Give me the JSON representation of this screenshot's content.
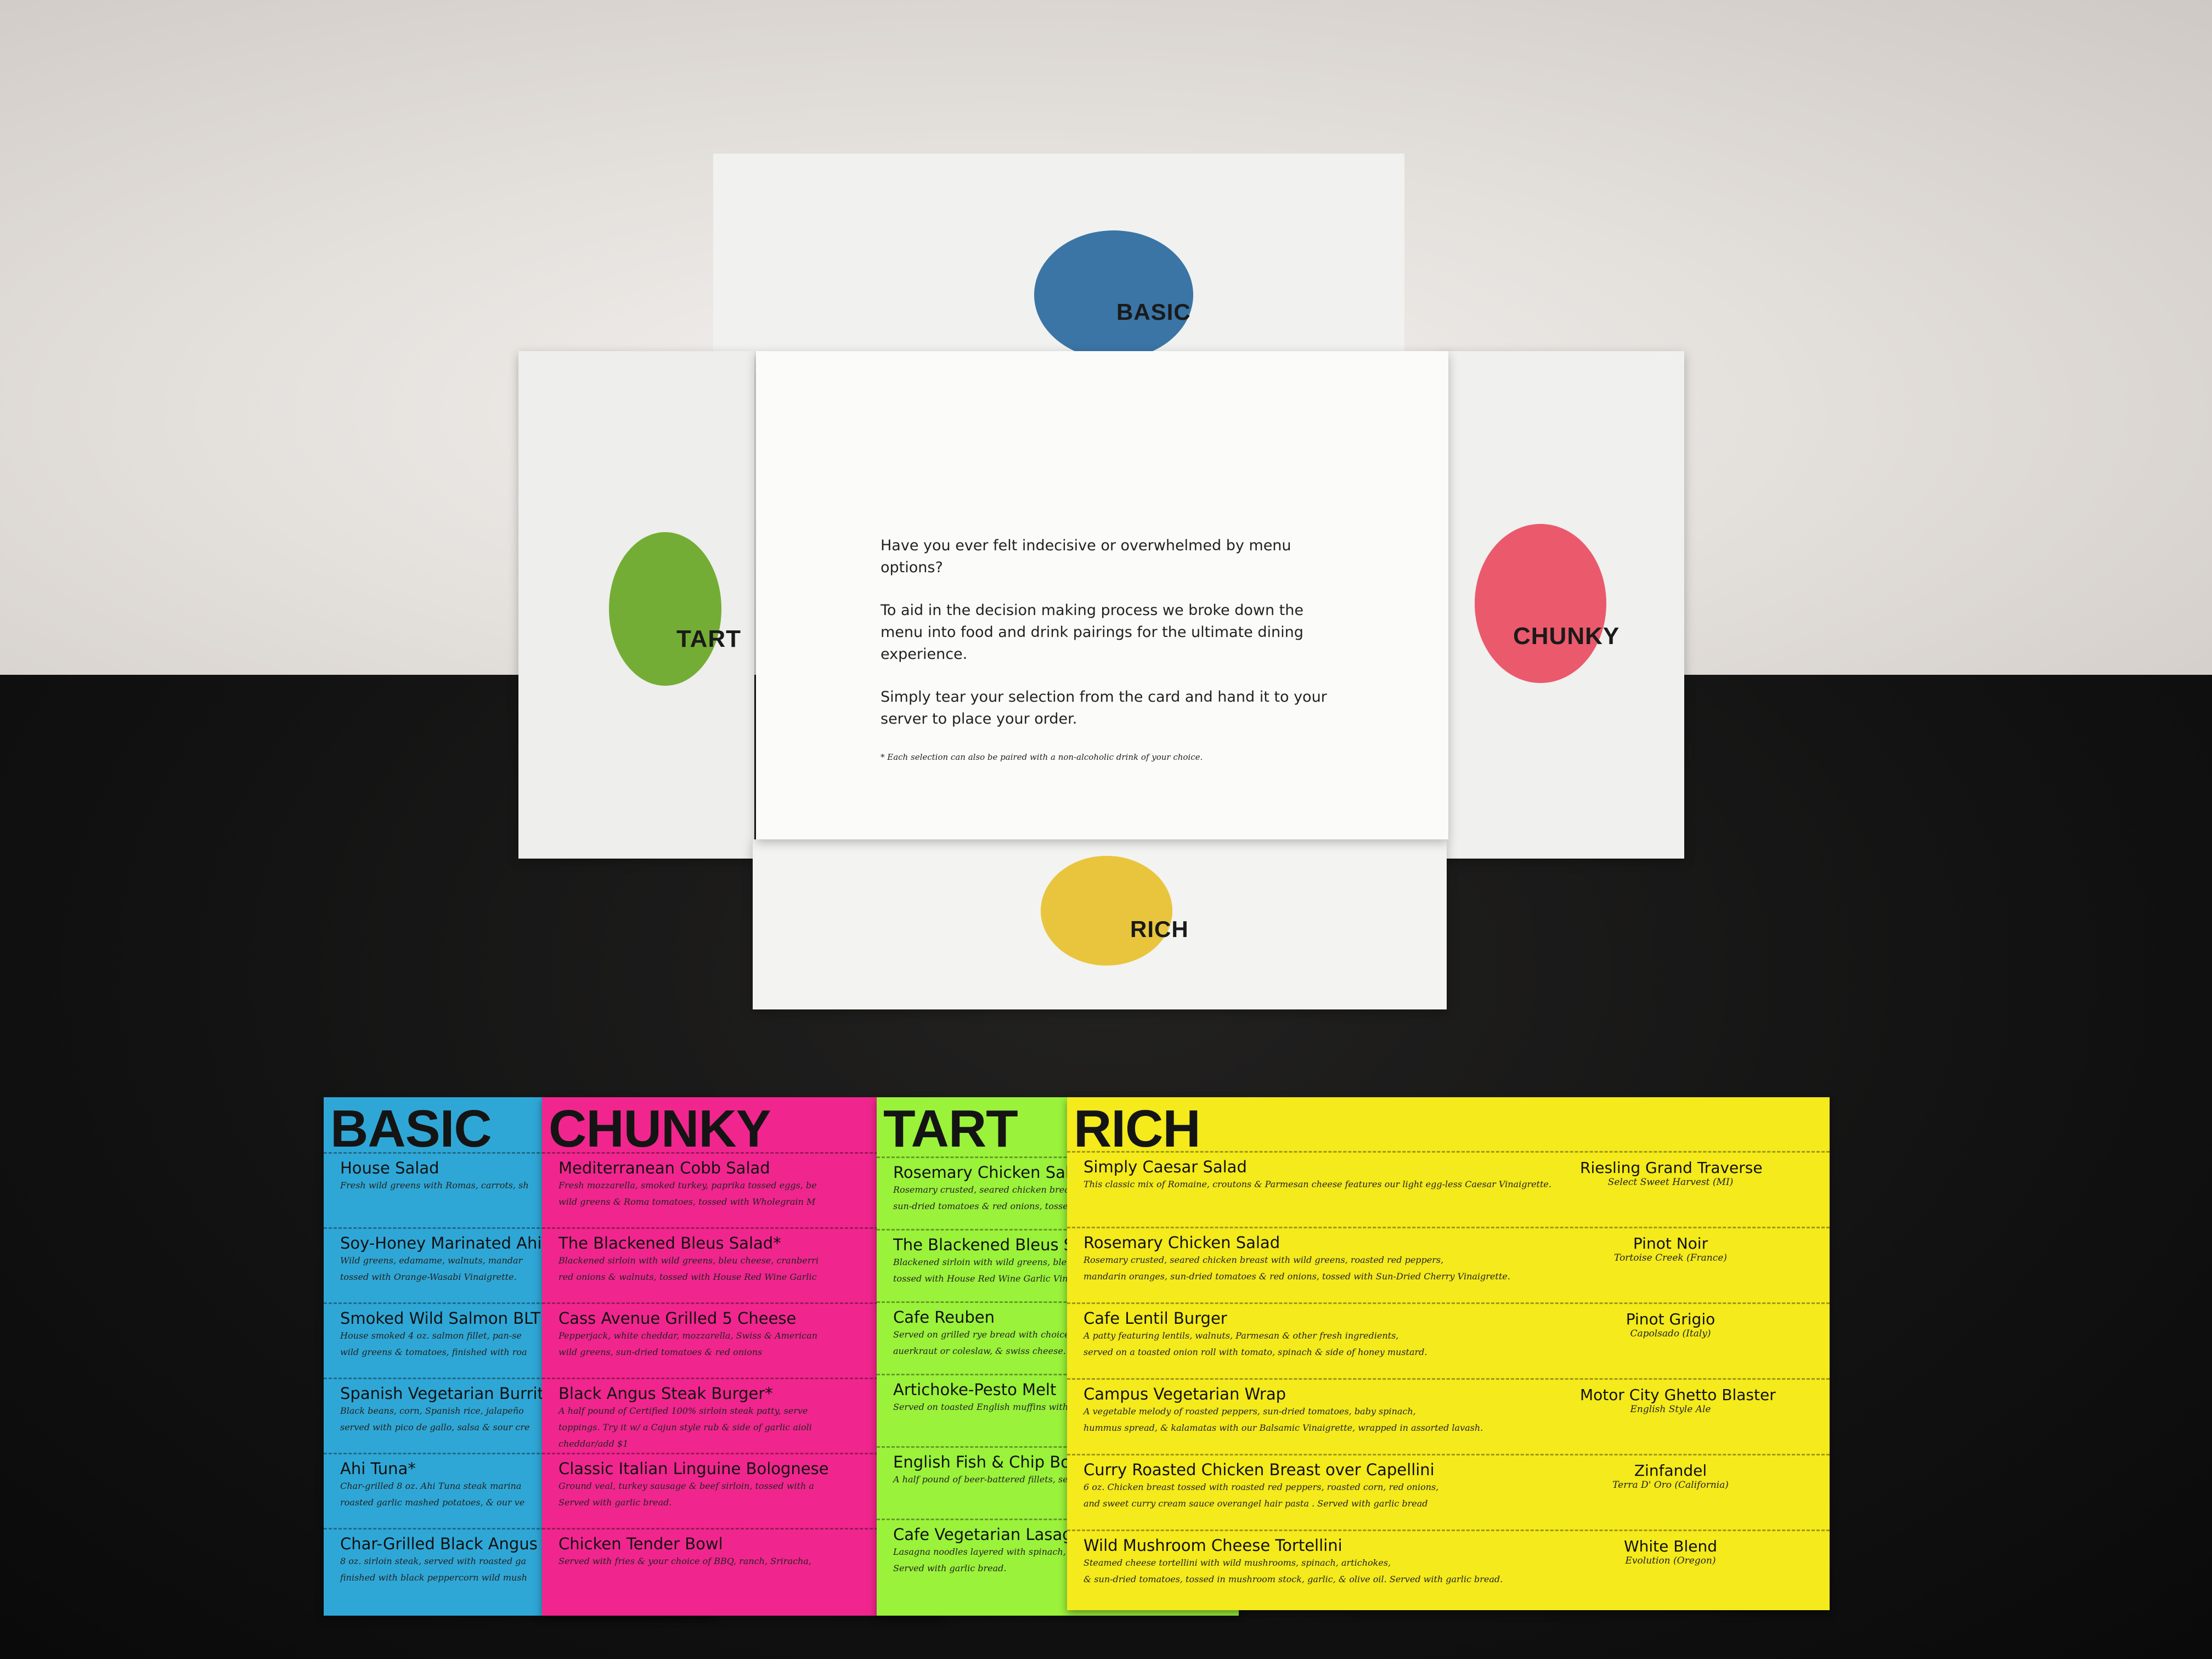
{
  "colors": {
    "basic": "#2fa7d6",
    "chunky": "#f0268e",
    "tart": "#9af23a",
    "rich": "#f4ea1c",
    "basic_circle": "#3a75a6",
    "tart_circle": "#74ad35",
    "chunky_circle": "#ea5a6c",
    "rich_circle": "#e8c53d"
  },
  "folder": {
    "flaps": {
      "top": "BASIC",
      "left": "TART",
      "right": "CHUNKY",
      "bottom": "RICH"
    },
    "intro": [
      "Have you ever felt indecisive or overwhelmed by menu options?",
      "To aid in the decision making process we broke down the menu into food and drink pairings for the ultimate dining experience.",
      "Simply tear your selection from the card and hand it to your server to place your order."
    ],
    "note": "* Each selection can also be paired with a non-alcoholic drink of your choice."
  },
  "cards": {
    "basic": {
      "title": "BASIC",
      "items": [
        {
          "name": "House Salad",
          "desc": "Fresh wild greens with Romas, carrots, sh"
        },
        {
          "name": "Soy-Honey Marinated Ahi",
          "desc": "Wild greens, edamame, walnuts, mandar\ntossed with Orange-Wasabi Vinaigrette."
        },
        {
          "name": "Smoked Wild Salmon BLT",
          "desc": "House smoked 4 oz. salmon fillet, pan-se\nwild greens & tomatoes, finished with roa"
        },
        {
          "name": "Spanish Vegetarian Burrito",
          "desc": "Black beans, corn, Spanish rice, jalapeño\nserved with pico de gallo, salsa & sour cre"
        },
        {
          "name": "Ahi Tuna*",
          "desc": "Char-grilled 8 oz. Ahi Tuna steak marina\nroasted garlic mashed potatoes, & our ve"
        },
        {
          "name": "Char-Grilled Black Angus",
          "desc": "8 oz. sirloin steak, served with roasted ga\nfinished with black peppercorn wild mush"
        }
      ]
    },
    "chunky": {
      "title": "CHUNKY",
      "items": [
        {
          "name": "Mediterranean Cobb Salad",
          "desc": "Fresh mozzarella, smoked turkey, paprika tossed eggs, be\nwild greens & Roma tomatoes, tossed with Wholegrain M"
        },
        {
          "name": "The Blackened Bleus Salad*",
          "desc": "Blackened sirloin with wild greens, bleu cheese, cranberri\nred onions & walnuts, tossed with House Red Wine Garlic"
        },
        {
          "name": "Cass Avenue Grilled 5 Cheese",
          "desc": "Pepperjack, white cheddar, mozzarella, Swiss & American\nwild greens, sun-dried tomatoes & red onions"
        },
        {
          "name": "Black Angus Steak Burger*",
          "desc": "A half pound of Certified 100% sirloin steak patty, serve\ntoppings. Try it w/ a Cajun style rub & side of garlic aioli\ncheddar/add $1"
        },
        {
          "name": "Classic Italian Linguine Bolognese",
          "desc": "Ground veal, turkey sausage & beef sirloin, tossed with a\nServed with garlic bread."
        },
        {
          "name": "Chicken Tender Bowl",
          "desc": "Served with fries & your choice of BBQ, ranch, Sriracha,"
        }
      ]
    },
    "tart": {
      "title": "TART",
      "items": [
        {
          "name": "Rosemary Chicken Salad",
          "desc": "Rosemary crusted, seared chicken breast\nsun-dried tomatoes & red onions, tossed"
        },
        {
          "name": "The Blackened Bleus Salad",
          "desc": "Blackened sirloin with wild greens, bleu c\ntossed with House Red Wine Garlic Vina"
        },
        {
          "name": "Cafe Reuben",
          "desc": "Served on grilled rye bread with choice o\nauerkraut or coleslaw, & swiss cheese."
        },
        {
          "name": "Artichoke-Pesto Melt",
          "desc": "Served on toasted English muffins with t"
        },
        {
          "name": "English Fish & Chip Bowl",
          "desc": "A half pound of beer-battered fillets, ser"
        },
        {
          "name": "Cafe Vegetarian Lasagna",
          "desc": "Lasagna noodles layered with spinach, ba\nServed with garlic bread."
        }
      ]
    },
    "rich": {
      "title": "RICH",
      "items": [
        {
          "name": "Simply Caesar Salad",
          "desc": "This classic mix of Romaine, croutons & Parmesan cheese features our light egg-less Caesar Vinaigrette."
        },
        {
          "name": "Rosemary Chicken Salad",
          "desc": "Rosemary crusted, seared chicken breast with wild greens, roasted red peppers,\nmandarin oranges, sun-dried tomatoes & red onions, tossed with Sun-Dried Cherry Vinaigrette."
        },
        {
          "name": "Cafe Lentil Burger",
          "desc": "A patty featuring lentils, walnuts, Parmesan & other fresh ingredients,\nserved on a toasted onion roll with tomato, spinach & side of honey mustard."
        },
        {
          "name": "Campus Vegetarian Wrap",
          "desc": "A vegetable melody of roasted peppers, sun-dried tomatoes, baby spinach,\nhummus spread, & kalamatas with our Balsamic Vinaigrette, wrapped in assorted lavash."
        },
        {
          "name": "Curry Roasted Chicken Breast over Capellini",
          "desc": "6 oz. Chicken breast tossed with roasted red peppers, roasted corn, red onions,\nand sweet curry cream sauce overangel hair pasta . Served with garlic bread"
        },
        {
          "name": "Wild Mushroom Cheese Tortellini",
          "desc": "Steamed cheese tortellini with wild mushrooms, spinach, artichokes,\n& sun-dried tomatoes, tossed in mushroom stock, garlic, & olive oil. Served with garlic bread."
        }
      ],
      "drinks": [
        {
          "name": "Riesling Grand Traverse",
          "origin": "Select Sweet Harvest (MI)"
        },
        {
          "name": "Pinot Noir",
          "origin": "Tortoise Creek (France)"
        },
        {
          "name": "Pinot Grigio",
          "origin": "Capolsado (Italy)"
        },
        {
          "name": "Motor City Ghetto Blaster",
          "origin": "English Style Ale"
        },
        {
          "name": "Zinfandel",
          "origin": "Terra D' Oro (California)"
        },
        {
          "name": "White Blend",
          "origin": "Evolution (Oregon)"
        }
      ]
    }
  }
}
